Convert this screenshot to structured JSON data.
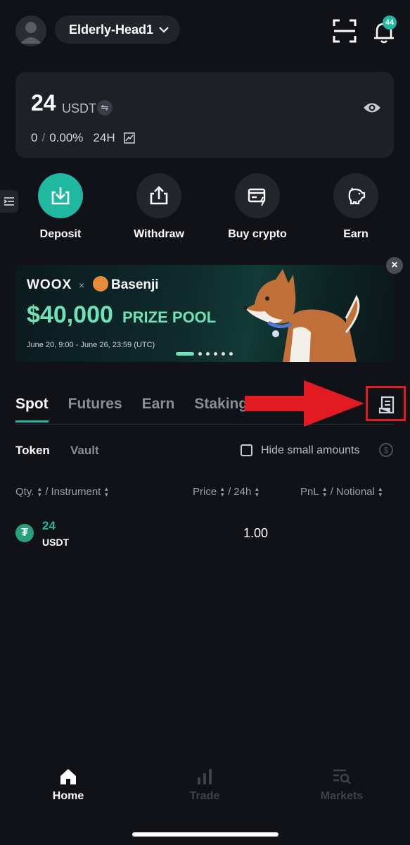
{
  "header": {
    "account_name": "Elderly-Head1",
    "notification_count": "44"
  },
  "balance": {
    "amount": "24",
    "unit": "USDT",
    "pnl_value": "0",
    "pnl_percent": "0.00%",
    "period": "24H"
  },
  "actions": [
    {
      "label": "Deposit",
      "icon": "download-icon"
    },
    {
      "label": "Withdraw",
      "icon": "upload-icon"
    },
    {
      "label": "Buy crypto",
      "icon": "card-icon"
    },
    {
      "label": "Earn",
      "icon": "piggy-bank-icon"
    }
  ],
  "banner": {
    "brand": "WOOX",
    "times": "×",
    "partner": "Basenji",
    "prize_amount": "$40,000",
    "prize_text": "PRIZE POOL",
    "dates": "June 20, 9:00 - June 26, 23:59 (UTC)",
    "close": "×"
  },
  "tabs": [
    "Spot",
    "Futures",
    "Earn",
    "Staking"
  ],
  "subtabs": {
    "token": "Token",
    "vault": "Vault"
  },
  "filter": {
    "hide_small": "Hide small amounts"
  },
  "columns": {
    "qty": "Qty.",
    "instrument": "Instrument",
    "price": "Price",
    "change": "24h",
    "pnl": "PnL",
    "notional": "Notional"
  },
  "rows": [
    {
      "qty": "24",
      "instrument": "USDT",
      "price": "1.00",
      "icon_glyph": "₮"
    }
  ],
  "bottom_nav": [
    {
      "label": "Home",
      "active": true
    },
    {
      "label": "Trade",
      "active": false
    },
    {
      "label": "Markets",
      "active": false
    }
  ],
  "colors": {
    "accent": "#1fb8a0",
    "background": "#111217",
    "annotation_red": "#e21b23"
  }
}
